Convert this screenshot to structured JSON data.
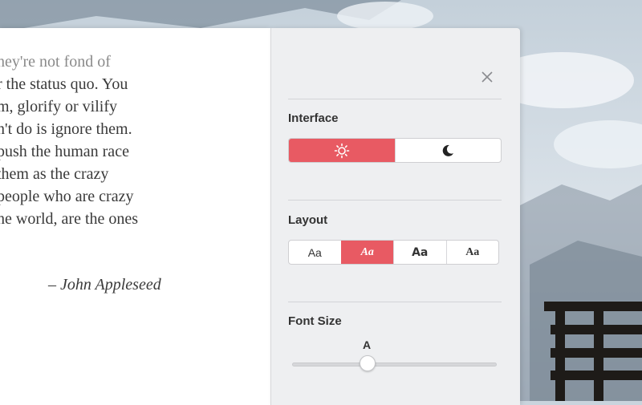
{
  "quote": {
    "lines": [
      "hey're not fond of",
      "r the status quo. You",
      "m, glorify or vilify",
      "n't do is ignore them.",
      "push the human race",
      "them as the crazy",
      "people who are crazy",
      "he world, are the ones"
    ],
    "author": "– John Appleseed"
  },
  "settings": {
    "interface": {
      "title": "Interface",
      "options": [
        {
          "icon": "sun-icon",
          "active": true
        },
        {
          "icon": "moon-icon",
          "active": false
        }
      ]
    },
    "layout": {
      "title": "Layout",
      "options": [
        {
          "label": "Aa",
          "active": false
        },
        {
          "label": "Aa",
          "active": true
        },
        {
          "label": "Aa",
          "active": false
        },
        {
          "label": "Aa",
          "active": false
        }
      ]
    },
    "font_size": {
      "title": "Font Size",
      "label": "A",
      "level": 0.37
    }
  },
  "colors": {
    "accent": "#e85a63",
    "panel_bg": "#eeeff1",
    "page_bg": "#ffffff",
    "text": "#3a3a3a"
  }
}
